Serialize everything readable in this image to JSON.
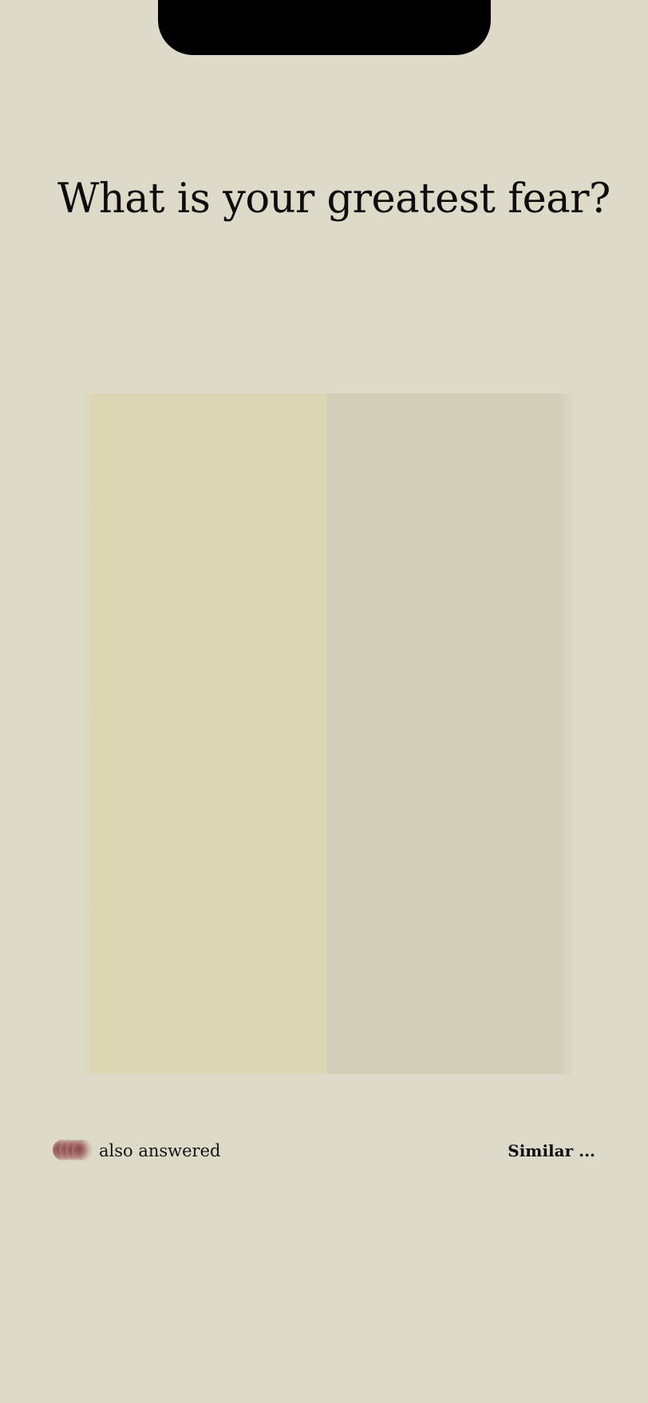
{
  "question": {
    "text": "What is your greatest fear?"
  },
  "cards": [
    {
      "name": "left-answer-card",
      "color": "#dcd6b4"
    },
    {
      "name": "right-answer-card",
      "color": "#d1cfba"
    }
  ],
  "footer": {
    "also_answered_label": "also answered",
    "avatars_icon": "avatar-stack-icon",
    "similar_label": "Similar ..."
  },
  "colors": {
    "background": "#dddac9",
    "text": "#0d0d0d",
    "avatar_accent": "#8a4a4a"
  }
}
